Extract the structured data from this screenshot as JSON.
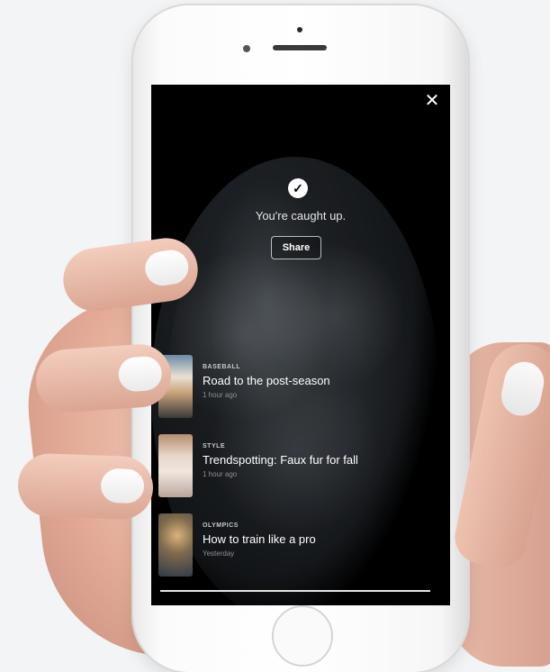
{
  "screen": {
    "caught_up_text": "You're caught up.",
    "share_label": "Share",
    "close_symbol": "✕",
    "check_symbol": "✓"
  },
  "stories": [
    {
      "category": "BASEBALL",
      "headline": "Road to the post-season",
      "time": "1 hour ago",
      "thumbnail": "baseball-player-photo"
    },
    {
      "category": "STYLE",
      "headline": "Trendspotting: Faux fur for fall",
      "time": "1 hour ago",
      "thumbnail": "fashion-photo"
    },
    {
      "category": "OLYMPICS",
      "headline": "How to train like a pro",
      "time": "Yesterday",
      "thumbnail": "athlete-photo"
    }
  ],
  "colors": {
    "screen_bg": "#000000",
    "text": "#ffffff",
    "muted": "#8f8f8f"
  }
}
